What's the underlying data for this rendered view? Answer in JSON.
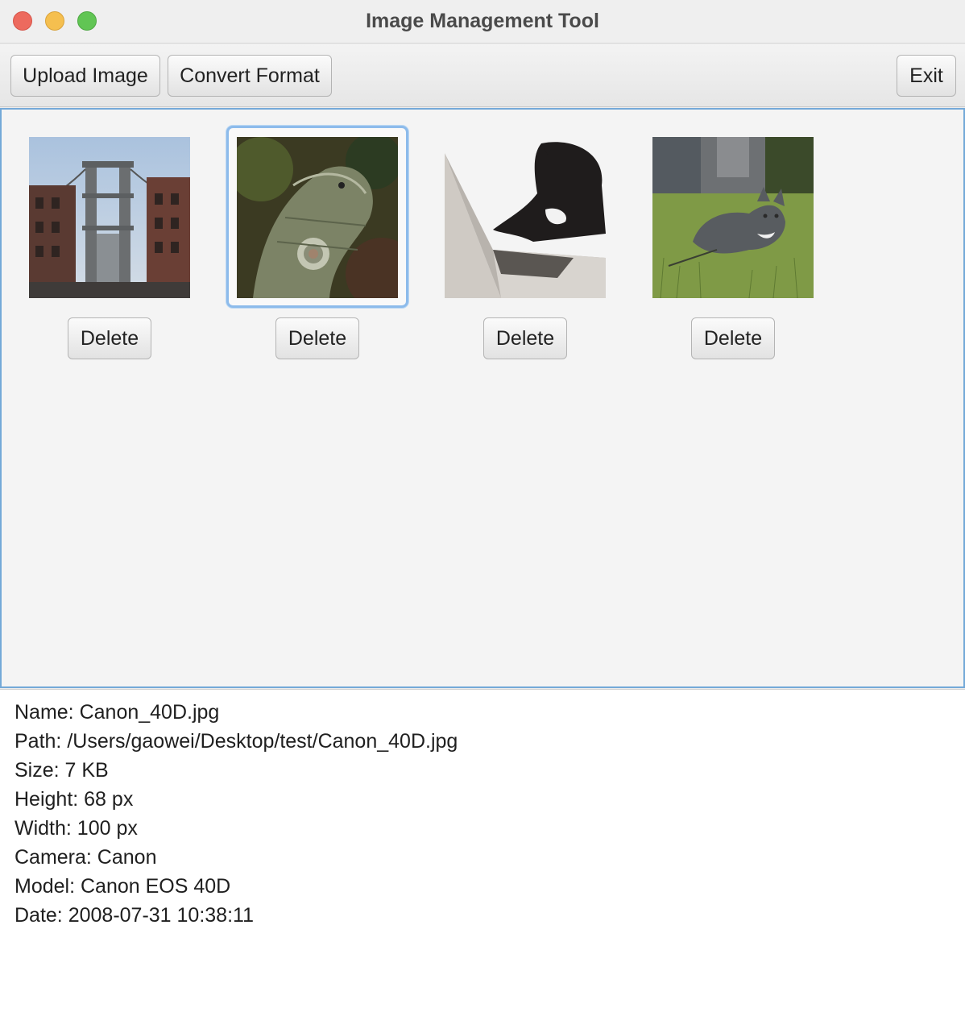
{
  "window": {
    "title": "Image Management Tool"
  },
  "toolbar": {
    "upload_label": "Upload Image",
    "convert_label": "Convert Format",
    "exit_label": "Exit"
  },
  "gallery": {
    "selected_index": 1,
    "items": [
      {
        "subject": "bridge-cityscape",
        "delete_label": "Delete"
      },
      {
        "subject": "iguana",
        "delete_label": "Delete"
      },
      {
        "subject": "cat-on-laptop",
        "delete_label": "Delete"
      },
      {
        "subject": "cat-on-grass",
        "delete_label": "Delete"
      }
    ]
  },
  "details": {
    "name": "Name: Canon_40D.jpg",
    "path": "Path: /Users/gaowei/Desktop/test/Canon_40D.jpg",
    "size": "Size: 7 KB",
    "height": "Height: 68 px",
    "width": "Width: 100 px",
    "camera": "Camera: Canon",
    "model": "Model: Canon EOS 40D",
    "date": "Date: 2008-07-31 10:38:11"
  },
  "colors": {
    "selection_border": "#8dbbeb",
    "gallery_border": "#74a9d8",
    "close": "#ed6a5e",
    "minimize": "#f5bf4f",
    "maximize": "#61c554"
  }
}
